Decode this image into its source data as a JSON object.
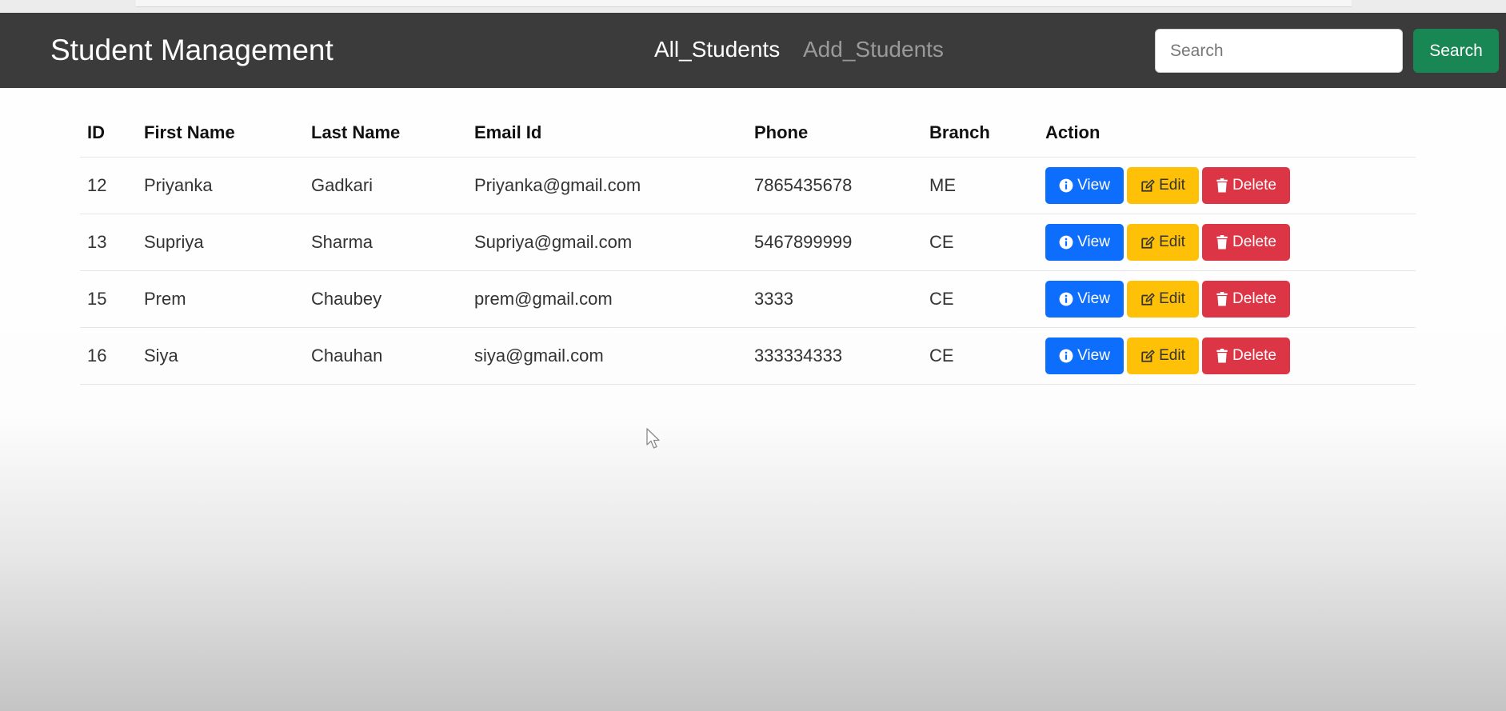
{
  "navbar": {
    "brand": "Student Management",
    "links": [
      {
        "label": "All_Students",
        "active": true
      },
      {
        "label": "Add_Students",
        "active": false
      }
    ],
    "search": {
      "placeholder": "Search",
      "value": ""
    },
    "search_button": "Search"
  },
  "table": {
    "headers": {
      "id": "ID",
      "first_name": "First Name",
      "last_name": "Last Name",
      "email": "Email Id",
      "phone": "Phone",
      "branch": "Branch",
      "action": "Action"
    },
    "rows": [
      {
        "id": "12",
        "first_name": "Priyanka",
        "last_name": "Gadkari",
        "email": "Priyanka@gmail.com",
        "phone": "7865435678",
        "branch": "ME"
      },
      {
        "id": "13",
        "first_name": "Supriya",
        "last_name": "Sharma",
        "email": "Supriya@gmail.com",
        "phone": "5467899999",
        "branch": "CE"
      },
      {
        "id": "15",
        "first_name": "Prem",
        "last_name": "Chaubey",
        "email": "prem@gmail.com",
        "phone": "3333",
        "branch": "CE"
      },
      {
        "id": "16",
        "first_name": "Siya",
        "last_name": "Chauhan",
        "email": "siya@gmail.com",
        "phone": "333334333",
        "branch": "CE"
      }
    ],
    "actions": {
      "view": "View",
      "edit": "Edit",
      "delete": "Delete"
    }
  },
  "colors": {
    "navbar_bg": "#3b3b3b",
    "search_button": "#198754",
    "view_button": "#0d6efd",
    "edit_button": "#ffc107",
    "delete_button": "#dc3545"
  },
  "icons": {
    "view": "info-circle-icon",
    "edit": "pencil-square-icon",
    "delete": "trash-icon",
    "cursor": "mouse-pointer-icon"
  }
}
